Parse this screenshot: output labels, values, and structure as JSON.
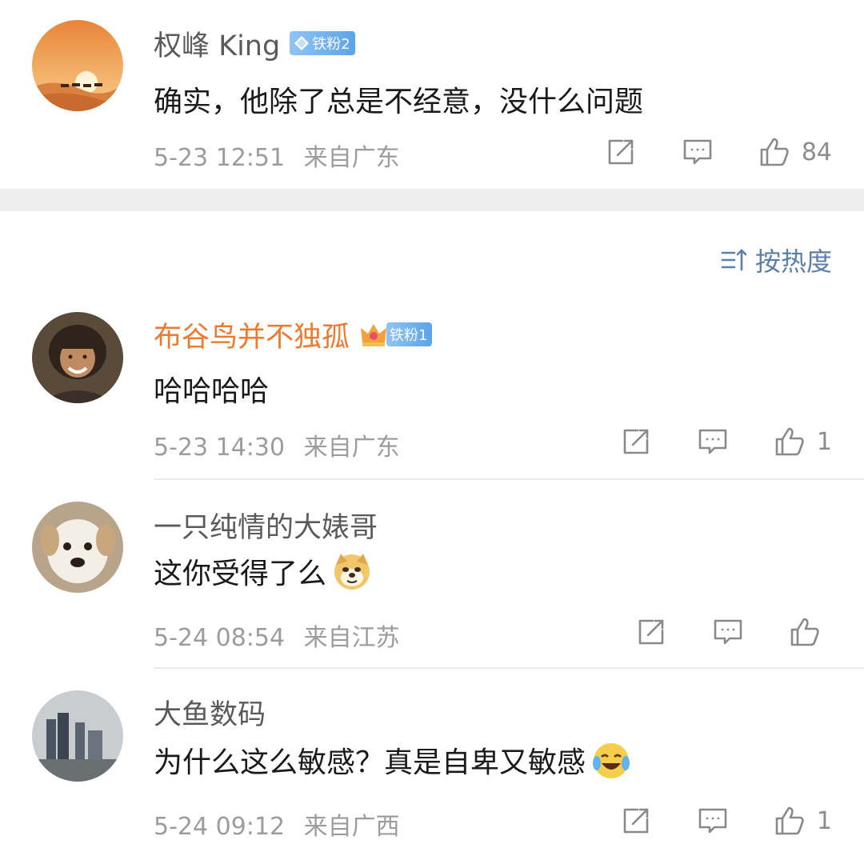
{
  "sort": {
    "label": "按热度",
    "icon": "sort-icon"
  },
  "comments": [
    {
      "username": "权峰 King",
      "badge": "铁粉2",
      "text": "确实，他除了总是不经意，没什么问题",
      "time": "5-23 12:51",
      "location": "来自广东",
      "likes": "84"
    },
    {
      "username": "布谷鸟并不独孤",
      "badge": "铁粉1",
      "text": "哈哈哈哈",
      "time": "5-23 14:30",
      "location": "来自广东",
      "likes": "1"
    },
    {
      "username": "一只纯情的大婊哥",
      "text": "这你受得了么",
      "emoji": "doge-emoji",
      "time": "5-24 08:54",
      "location": "来自江苏",
      "likes": ""
    },
    {
      "username": "大鱼数码",
      "text": "为什么这么敏感？真是自卑又敏感",
      "emoji": "laugh-cry-emoji",
      "time": "5-24 09:12",
      "location": "来自广西",
      "likes": "1"
    }
  ],
  "colors": {
    "name_default": "#5a5a5a",
    "name_vip": "#ee7a2f",
    "sort_link": "#5a7fa8",
    "badge_blue": "#5aa4ec"
  }
}
